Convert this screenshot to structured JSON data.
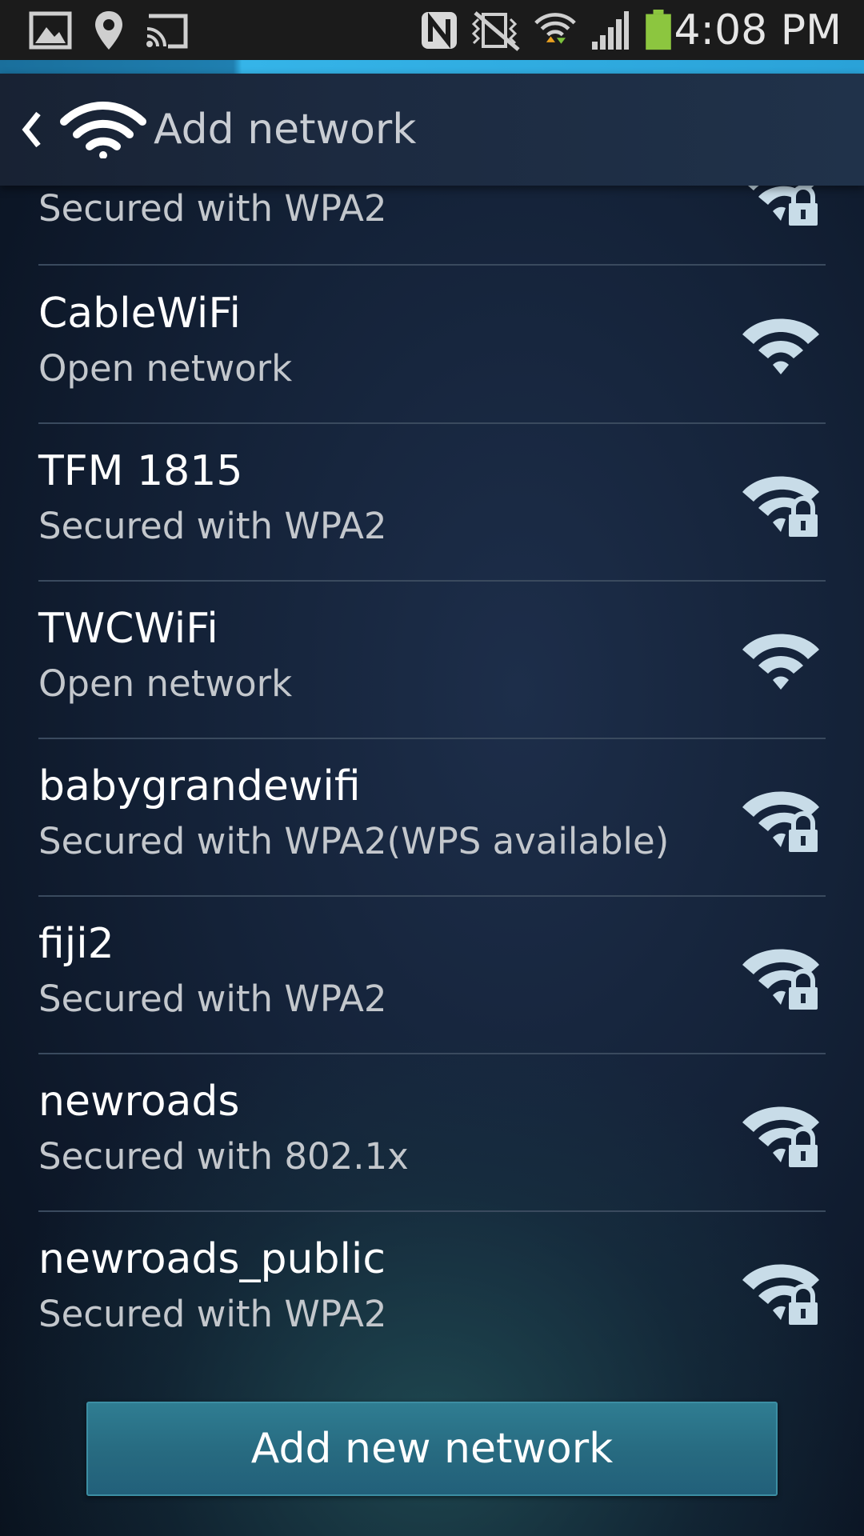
{
  "status_bar": {
    "time": "4:08 PM",
    "icons": [
      "image-icon",
      "location-icon",
      "cast-icon",
      "nfc-icon",
      "vibrate-icon",
      "wifi-data-icon",
      "cell-signal-icon",
      "battery-icon"
    ],
    "battery_color": "#8cc63f"
  },
  "header": {
    "title": "Add network",
    "back_icon": "chevron-left-icon",
    "app_icon": "wifi-icon"
  },
  "networks": {
    "partial": {
      "security": "Secured with WPA2",
      "locked": true
    },
    "items": [
      {
        "name": "CableWiFi",
        "security": "Open network",
        "locked": false
      },
      {
        "name": "TFM 1815",
        "security": "Secured with WPA2",
        "locked": true
      },
      {
        "name": "TWCWiFi",
        "security": "Open network",
        "locked": false
      },
      {
        "name": "babygrandewifi",
        "security": "Secured with WPA2(WPS available)",
        "locked": true
      },
      {
        "name": "fiji2",
        "security": "Secured with WPA2",
        "locked": true
      },
      {
        "name": "newroads",
        "security": "Secured with 802.1x",
        "locked": true
      },
      {
        "name": "newroads_public",
        "security": "Secured with WPA2",
        "locked": true
      }
    ]
  },
  "footer": {
    "add_button_label": "Add new network"
  },
  "colors": {
    "accent": "#35b4e8",
    "icon": "#c8dce8",
    "button": "#276a80"
  }
}
